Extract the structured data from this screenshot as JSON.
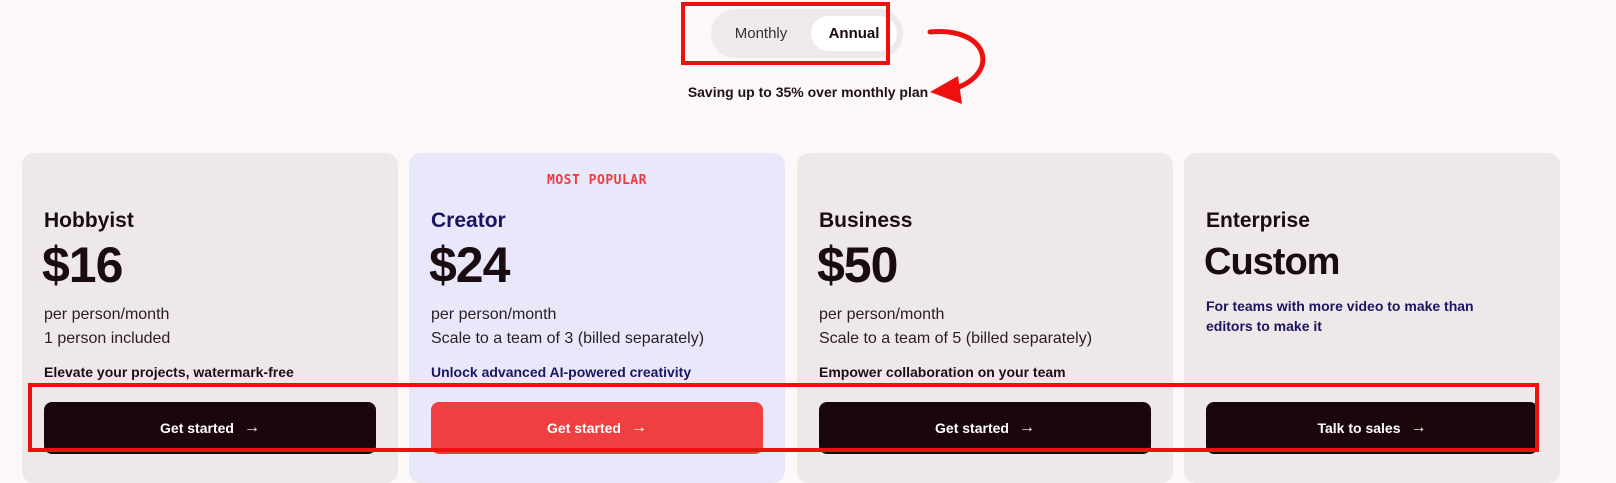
{
  "billing_toggle": {
    "options": [
      "Monthly",
      "Annual"
    ],
    "selected": "Annual"
  },
  "saving_note": "Saving up to 35% over monthly plan",
  "badge": "MOST POPULAR",
  "plans": [
    {
      "name": "Hobbyist",
      "price": "$16",
      "period": "per person/month",
      "team": "1 person included",
      "description": "Elevate your projects, watermark-free",
      "cta": "Get started"
    },
    {
      "name": "Creator",
      "price": "$24",
      "period": "per person/month",
      "team": "Scale to a team of 3 (billed separately)",
      "description": "Unlock advanced AI-powered creativity",
      "cta": "Get started"
    },
    {
      "name": "Business",
      "price": "$50",
      "period": "per person/month",
      "team": "Scale to a team of 5 (billed separately)",
      "description": "Empower collaboration on your team",
      "cta": "Get started"
    },
    {
      "name": "Enterprise",
      "price": "Custom",
      "description": "For teams with more video to make than editors to make it",
      "cta": "Talk to sales"
    }
  ],
  "icons": {
    "cta_arrow": "arrow-right-icon"
  },
  "colors": {
    "accent": "#ef3f40",
    "dark_button": "#1a070b",
    "featured_card": "#e9e8fb",
    "card": "#efe8e9",
    "annotation": "#ee0f0f"
  }
}
